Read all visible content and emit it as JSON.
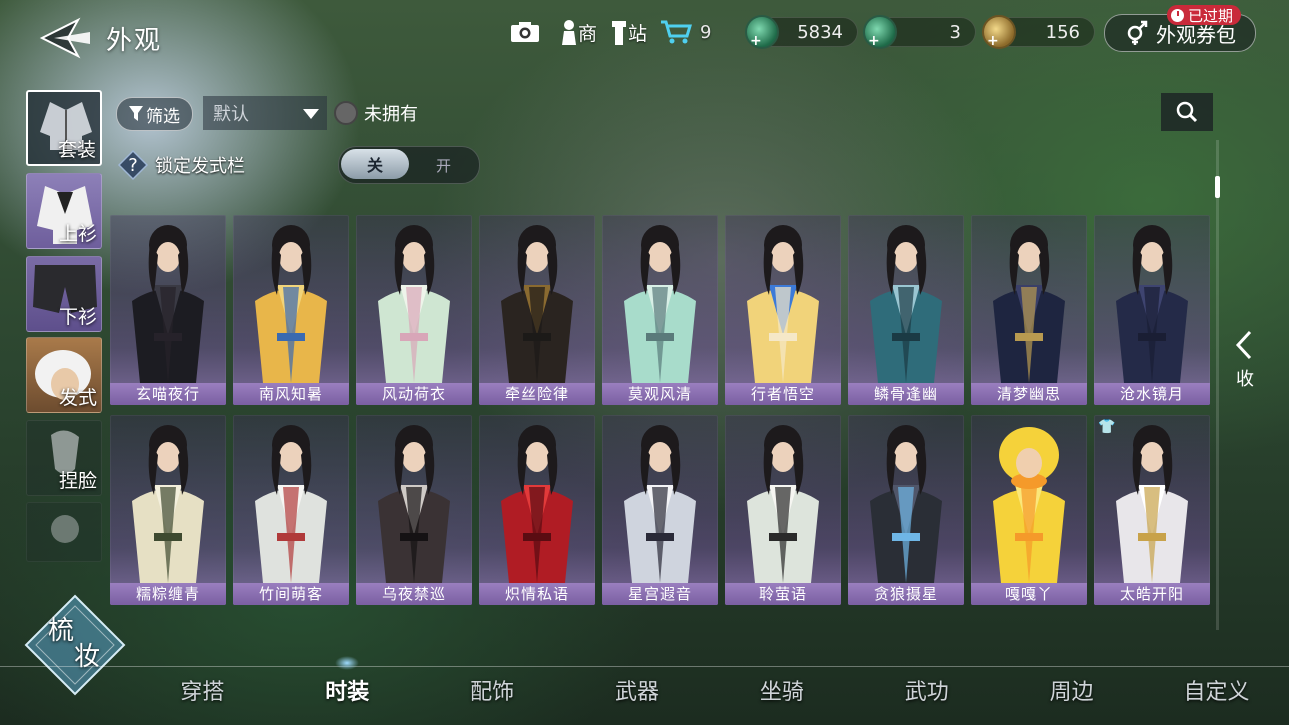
{
  "header": {
    "title": "外观",
    "shop_label": "商",
    "station_label": "站",
    "cart_count": "9",
    "currencies": [
      {
        "name": "jade-coin",
        "value": "5834"
      },
      {
        "name": "jade-ring",
        "value": "3"
      },
      {
        "name": "gold-coin",
        "value": "156"
      }
    ],
    "voucher_label": "外观券包",
    "expired_badge": "已过期"
  },
  "side_tabs": [
    {
      "label": "套装",
      "active": true
    },
    {
      "label": "上衫",
      "active": false
    },
    {
      "label": "下衫",
      "active": false
    },
    {
      "label": "发式",
      "active": false
    },
    {
      "label": "捏脸",
      "active": false
    }
  ],
  "logo": {
    "line1": "梳",
    "line2": "妆"
  },
  "filters": {
    "filter_label": "筛选",
    "sort_value": "默认",
    "owned_label": "未拥有",
    "lock_hair_label": "锁定发式栏",
    "switch_off": "关",
    "switch_on": "开"
  },
  "outfits": [
    {
      "name": "玄喵夜行",
      "palette": "black"
    },
    {
      "name": "南风知暑",
      "palette": "gold"
    },
    {
      "name": "风动荷衣",
      "palette": "mint"
    },
    {
      "name": "牵丝险律",
      "palette": "darkgold"
    },
    {
      "name": "莫观风清",
      "palette": "jade"
    },
    {
      "name": "行者悟空",
      "palette": "blue"
    },
    {
      "name": "鳞骨逢幽",
      "palette": "teal"
    },
    {
      "name": "清梦幽思",
      "palette": "navy"
    },
    {
      "name": "沧水镜月",
      "palette": "indigo"
    },
    {
      "name": "糯粽缠青",
      "palette": "cream"
    },
    {
      "name": "竹间萌客",
      "palette": "white"
    },
    {
      "name": "乌夜禁巡",
      "palette": "smoke"
    },
    {
      "name": "炽情私语",
      "palette": "red"
    },
    {
      "name": "星宫遐音",
      "palette": "silver"
    },
    {
      "name": "聆萤语",
      "palette": "pale"
    },
    {
      "name": "贪狼摄星",
      "palette": "charcoal"
    },
    {
      "name": "嘎嘎丫",
      "palette": "yellow"
    },
    {
      "name": "太皓开阳",
      "palette": "ivory"
    }
  ],
  "collapse_label": "收",
  "bottom_nav": [
    {
      "label": "穿搭",
      "active": false
    },
    {
      "label": "时装",
      "active": true
    },
    {
      "label": "配饰",
      "active": false
    },
    {
      "label": "武器",
      "active": false
    },
    {
      "label": "坐骑",
      "active": false
    },
    {
      "label": "武功",
      "active": false
    },
    {
      "label": "周边",
      "active": false
    },
    {
      "label": "自定义",
      "active": false
    }
  ]
}
